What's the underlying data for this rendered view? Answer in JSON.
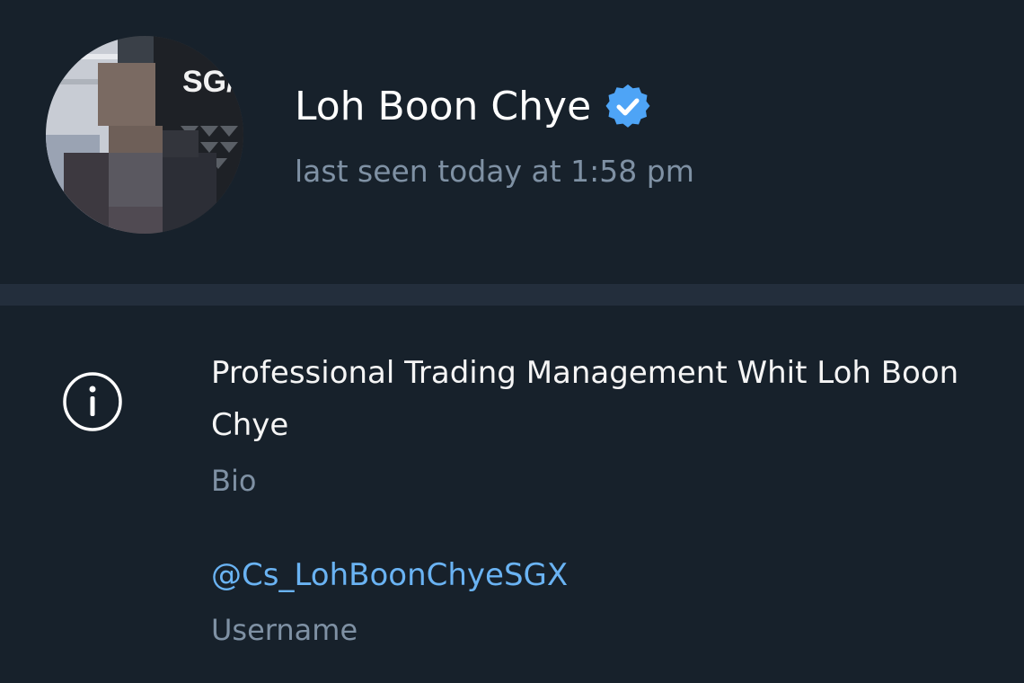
{
  "profile": {
    "name": "Loh Boon Chye",
    "status": "last seen today at 1:58 pm",
    "verified_icon": "verified-badge-icon",
    "avatar_sign_text": "SG/"
  },
  "info": {
    "icon": "info-icon",
    "bio": "Professional Trading Management Whit Loh Boon Chye",
    "bio_label": "Bio",
    "username": "@Cs_LohBoonChyeSGX",
    "username_label": "Username"
  },
  "colors": {
    "background": "#17212b",
    "divider": "#232e3c",
    "secondary_text": "#7f91a4",
    "link": "#6ab3f3",
    "verified": "#4ea4f6"
  }
}
